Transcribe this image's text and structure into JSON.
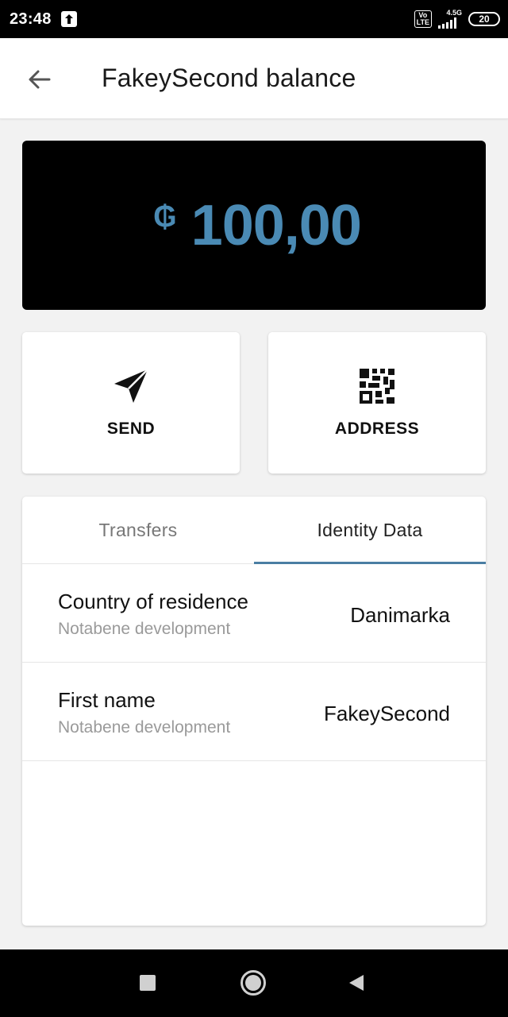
{
  "status_bar": {
    "time": "23:48",
    "volte_label": "Vo\nLTE",
    "network_type": "4.5G",
    "battery": "20",
    "icons": [
      "upload-icon",
      "volte-icon",
      "signal-icon",
      "battery-icon"
    ]
  },
  "app_bar": {
    "title": "FakeySecond balance",
    "back_icon": "arrow-left-icon"
  },
  "balance": {
    "currency_symbol": "₲",
    "amount": "100,00",
    "color": "#4a8ab4",
    "background": "#000000"
  },
  "actions": {
    "send_label": "SEND",
    "send_icon": "paper-plane-icon",
    "address_label": "ADDRESS",
    "address_icon": "qr-code-icon"
  },
  "tabs": {
    "items": [
      {
        "label": "Transfers",
        "selected": false
      },
      {
        "label": "Identity Data",
        "selected": true
      }
    ],
    "indicator_color": "#4a7ea3"
  },
  "identity_rows": [
    {
      "title": "Country of residence",
      "subtitle": "Notabene development",
      "value": "Danimarka"
    },
    {
      "title": "First name",
      "subtitle": "Notabene development",
      "value": "FakeySecond"
    }
  ],
  "nav_bar": {
    "icons": [
      "recents-square-icon",
      "home-circle-icon",
      "back-triangle-icon"
    ]
  }
}
